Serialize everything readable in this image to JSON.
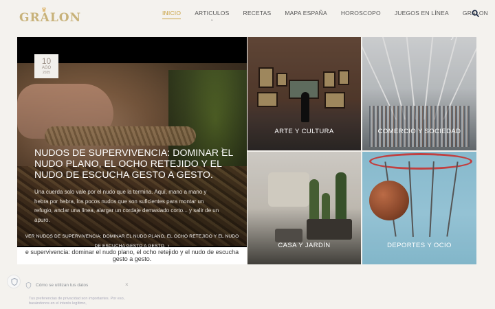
{
  "site": {
    "logo_text": "GRALON",
    "accent": "#c8a040"
  },
  "nav": {
    "items": [
      {
        "label": "INICIO",
        "active": true
      },
      {
        "label": "ARTICULOS",
        "has_dropdown": true
      },
      {
        "label": "RECETAS"
      },
      {
        "label": "MAPA ESPAÑA"
      },
      {
        "label": "HOROSCOPO"
      },
      {
        "label": "JUEGOS EN LÍNEA"
      },
      {
        "label": "GRALON"
      }
    ],
    "search_icon": "search-icon"
  },
  "hero": {
    "date_day": "10",
    "date_month": "AGO",
    "date_year": "2025",
    "title": "NUDOS DE SUPERVIVENCIA: DOMINAR EL NUDO PLANO, EL OCHO RETEJIDO Y EL NUDO DE ESCUCHA GESTO A GESTO.",
    "excerpt": "Una cuerda solo vale por el nudo que la termina. Aquí, mano a mano y hebra por hebra, los pocos nudos que son suficientes para montar un refugio, anclar una línea, alargar un cordaje demasiado corto... y salir de un apuro.",
    "link_label": "VER NUDOS DE SUPERVIVENCIA: DOMINAR EL NUDO PLANO, EL OCHO RETEJIDO Y EL NUDO DE ESCUCHA GESTO A GESTO.",
    "ticker": "e supervivencia: dominar el nudo plano, el ocho retejido y el nudo de escucha gesto a gesto."
  },
  "categories": [
    {
      "label": "ARTE Y CULTURA"
    },
    {
      "label": "COMERCIO Y SOCIEDAD"
    },
    {
      "label": "CASA Y JARDÍN"
    },
    {
      "label": "DEPORTES Y OCIO"
    }
  ],
  "consent": {
    "title": "Cómo se utilizan tus datos",
    "text": "Tus preferencias de privacidad son importantes. Por eso, basándonos en el interés legítimo,"
  }
}
